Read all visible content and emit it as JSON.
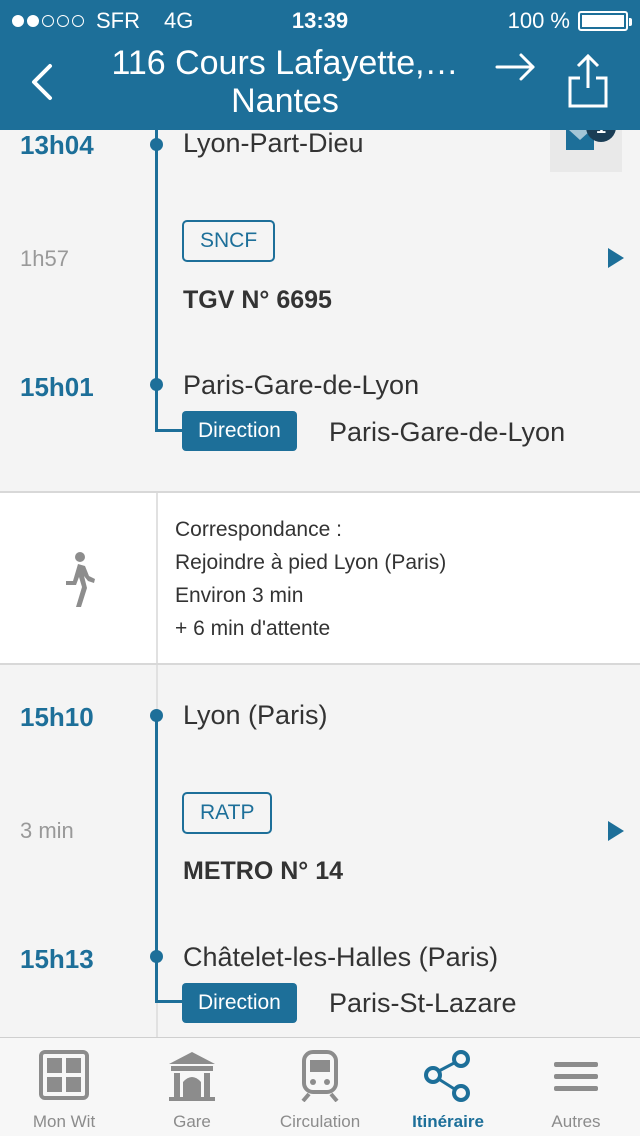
{
  "status_bar": {
    "carrier": "SFR",
    "network": "4G",
    "time": "13:39",
    "battery": "100 %",
    "signal_bars_filled": 2,
    "signal_bars_total": 5
  },
  "header": {
    "title": "116 Cours Lafayette,… Nantes",
    "icons": [
      "back-chevron-icon",
      "forward-arrow-icon",
      "share-icon"
    ]
  },
  "journey": {
    "leg1": {
      "dep_time": "13h04",
      "dep_stop": "Lyon-Part-Dieu",
      "duration": "1h57",
      "operator": "SNCF",
      "vehicle": "TGV N° 6695",
      "arr_time": "15h01",
      "arr_stop": "Paris-Gare-de-Lyon",
      "direction_label": "Direction",
      "direction": "Paris-Gare-de-Lyon"
    },
    "transfer": {
      "line1": "Correspondance :",
      "line2": "Rejoindre à pied Lyon (Paris)",
      "line3": "Environ 3 min",
      "line4": "+ 6 min d'attente"
    },
    "leg2": {
      "dep_time": "15h10",
      "dep_stop": "Lyon (Paris)",
      "duration": "3 min",
      "operator": "RATP",
      "vehicle": "METRO N° 14",
      "arr_time": "15h13",
      "arr_stop": "Châtelet-les-Halles (Paris)",
      "direction_label": "Direction",
      "direction": "Paris-St-Lazare"
    },
    "mail_badge_count": "1"
  },
  "tabbar": {
    "tabs": [
      {
        "label": "Mon Wit",
        "icon": "grid-icon"
      },
      {
        "label": "Gare",
        "icon": "station-icon"
      },
      {
        "label": "Circulation",
        "icon": "train-icon"
      },
      {
        "label": "Itinéraire",
        "icon": "route-icon"
      },
      {
        "label": "Autres",
        "icon": "menu-icon"
      }
    ],
    "active_index": 3
  },
  "colors": {
    "primary": "#1d6f99",
    "background": "#f4f4f4",
    "muted": "#999999"
  }
}
